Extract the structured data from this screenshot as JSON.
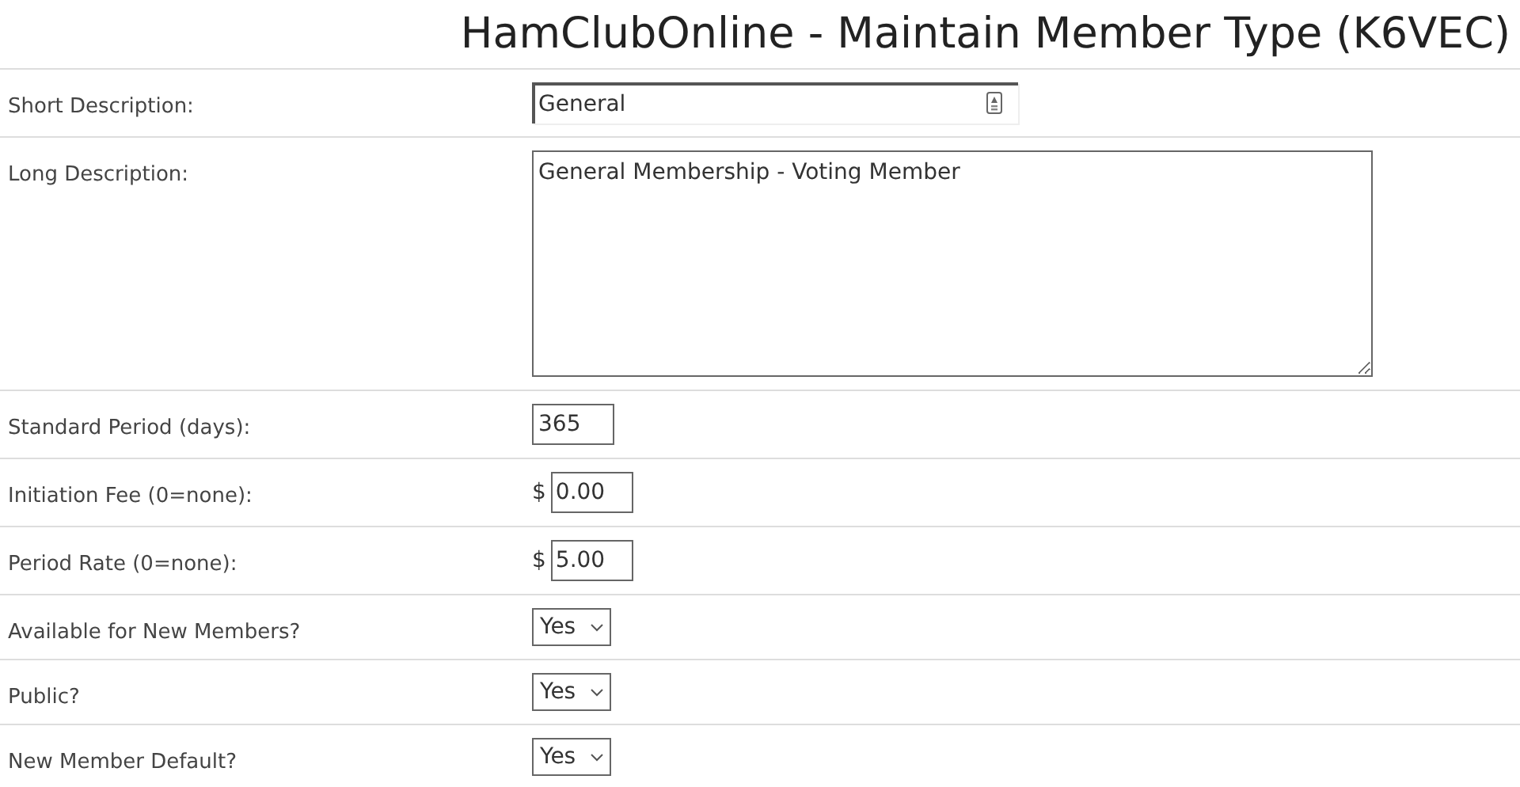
{
  "title": "HamClubOnline - Maintain Member Type (K6VEC)",
  "rows": [
    {
      "label": "Short Description:",
      "kind": "text",
      "value": "General"
    },
    {
      "label": "Long Description:",
      "kind": "textarea",
      "value": "General Membership - Voting Member"
    },
    {
      "label": "Standard Period (days):",
      "kind": "number",
      "value": "365"
    },
    {
      "label": "Initiation Fee (0=none):",
      "kind": "currency",
      "prefix": "$",
      "value": "0.00"
    },
    {
      "label": "Period Rate (0=none):",
      "kind": "currency",
      "prefix": "$",
      "value": "5.00"
    },
    {
      "label": "Available for New Members?",
      "kind": "select",
      "value": "Yes"
    },
    {
      "label": "Public?",
      "kind": "select",
      "value": "Yes"
    },
    {
      "label": "New Member Default?",
      "kind": "select",
      "value": "Yes"
    }
  ]
}
